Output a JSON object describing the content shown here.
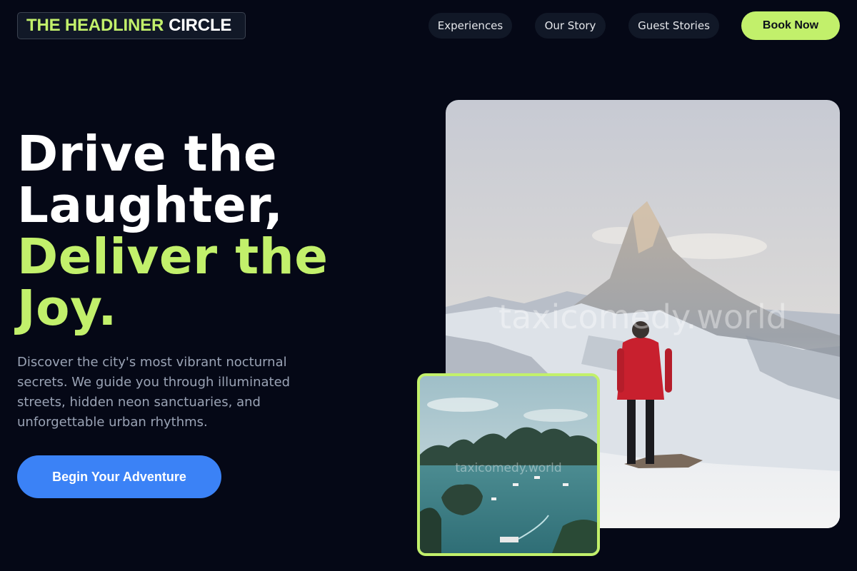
{
  "header": {
    "logo": {
      "accent_text": "THE HEADLINER",
      "rest_text": "CIRCLE"
    },
    "nav": [
      {
        "label": "Experiences"
      },
      {
        "label": "Our Story"
      },
      {
        "label": "Guest Stories"
      }
    ],
    "book_label": "Book Now"
  },
  "hero": {
    "headline_white_1": "Drive the",
    "headline_white_2": "Laughter,",
    "headline_green_1": "Deliver the",
    "headline_green_2": "Joy.",
    "description": "Discover the city's most vibrant nocturnal secrets. We guide you through illuminated streets, hidden neon sanctuaries, and unforgettable urban rhythms.",
    "cta_label": "Begin Your Adventure"
  },
  "images": {
    "main_watermark": "taxicomedy.world",
    "small_watermark": "taxicomedy.world"
  },
  "colors": {
    "background": "#050816",
    "accent_green": "#c2f06b",
    "cta_blue": "#3b82f6",
    "muted_text": "#9aa3b5"
  }
}
